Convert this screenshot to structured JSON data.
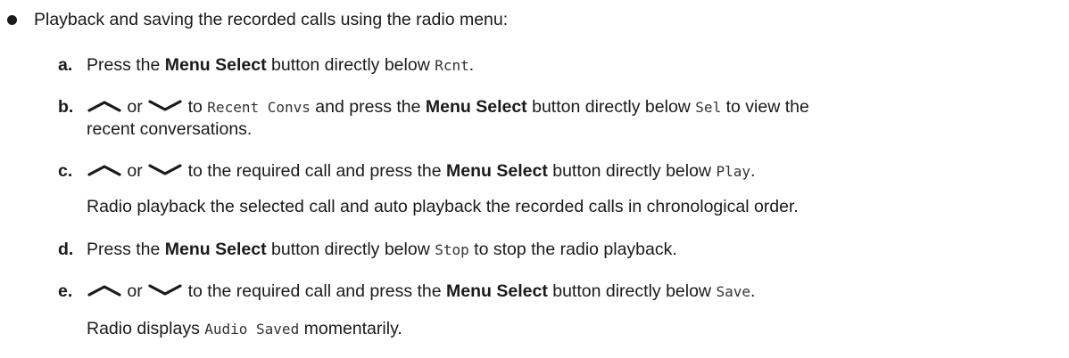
{
  "intro": "Playback and saving the recorded calls using the radio menu:",
  "steps": {
    "a": {
      "label": "a.",
      "t1": "Press the ",
      "b1": "Menu Select",
      "t2": " button directly below ",
      "m1": "Rcnt",
      "t3": "."
    },
    "b": {
      "label": "b.",
      "or": " or ",
      "t1": " to ",
      "m1": "Recent Convs",
      "t2": " and press the ",
      "b1": "Menu Select",
      "t3": " button directly below ",
      "m2": "Sel",
      "t4": " to view the",
      "line2": "recent conversations."
    },
    "c": {
      "label": "c.",
      "or": " or ",
      "t1": " to the required call and press the ",
      "b1": "Menu Select",
      "t2": " button directly below ",
      "m1": "Play",
      "t3": ".",
      "note": "Radio playback the selected call and auto playback the recorded calls in chronological order."
    },
    "d": {
      "label": "d.",
      "t1": "Press the ",
      "b1": "Menu Select",
      "t2": " button directly below ",
      "m1": "Stop",
      "t3": " to stop the radio playback."
    },
    "e": {
      "label": "e.",
      "or": " or ",
      "t1": " to the required call and press the ",
      "b1": "Menu Select",
      "t2": " button directly below ",
      "m1": "Save",
      "t3": ".",
      "note_t1": "Radio displays ",
      "note_m1": "Audio Saved",
      "note_t2": " momentarily."
    }
  },
  "icons": {
    "up": "chevron-up-icon",
    "down": "chevron-down-icon"
  }
}
